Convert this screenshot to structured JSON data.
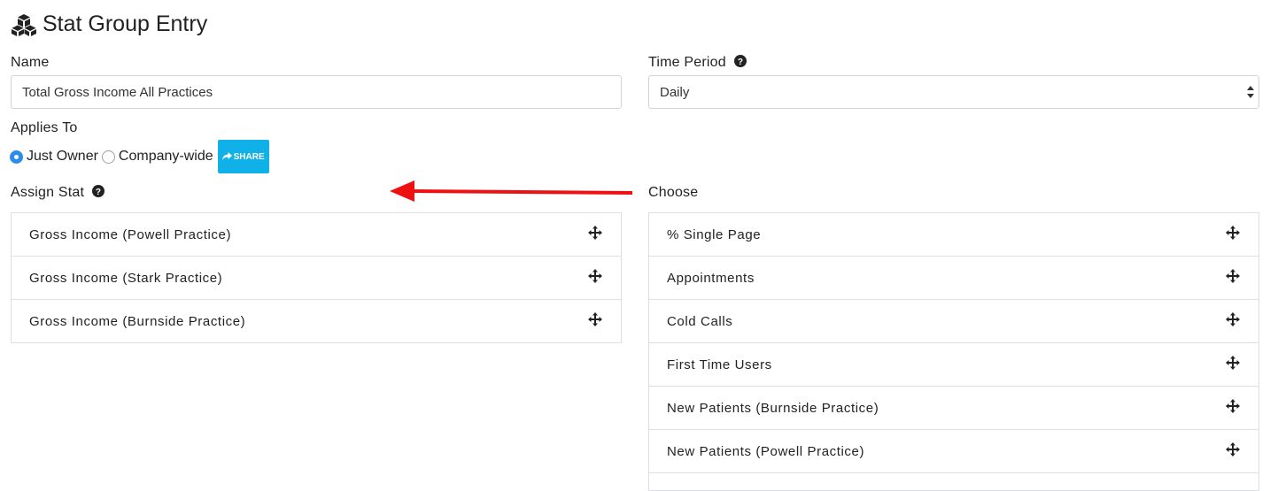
{
  "page": {
    "title": "Stat Group Entry",
    "title_icon": "cubes-icon"
  },
  "form": {
    "name_label": "Name",
    "name_value": "Total Gross Income All Practices",
    "time_period_label": "Time Period",
    "time_period_value": "Daily",
    "applies_to_label": "Applies To",
    "applies_options": [
      {
        "label": "Just Owner",
        "checked": true
      },
      {
        "label": "Company-wide",
        "checked": false
      }
    ],
    "share_label": "SHARE",
    "share_icon": "share-arrow-icon"
  },
  "assign": {
    "label": "Assign Stat",
    "items": [
      {
        "label": "Gross Income (Powell Practice)"
      },
      {
        "label": "Gross Income (Stark Practice)"
      },
      {
        "label": "Gross Income (Burnside Practice)"
      }
    ]
  },
  "choose": {
    "label": "Choose",
    "items": [
      {
        "label": "% Single Page"
      },
      {
        "label": "Appointments"
      },
      {
        "label": "Cold Calls"
      },
      {
        "label": "First Time Users"
      },
      {
        "label": "New Patients (Burnside Practice)"
      },
      {
        "label": "New Patients (Powell Practice)"
      },
      {
        "label": ""
      }
    ]
  },
  "annotation": {
    "arrow_color": "#ee1111"
  },
  "colors": {
    "accent": "#10b1e9",
    "radio_checked": "#2d8ceb"
  }
}
